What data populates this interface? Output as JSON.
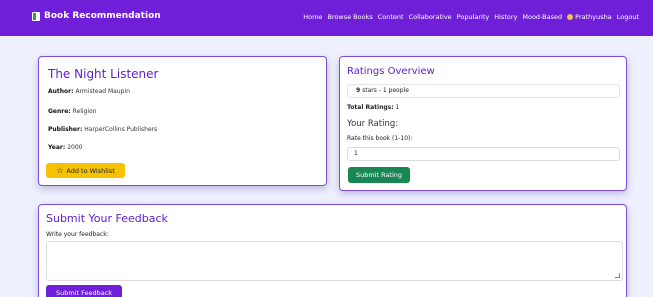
{
  "navbar": {
    "brand": "Book Recommendation",
    "links": [
      "Home",
      "Browse Books",
      "Content",
      "Collaborative",
      "Popularity",
      "History",
      "Mood-Based"
    ],
    "user": "Prathyusha",
    "logout": "Logout"
  },
  "book": {
    "title": "The Night Listener",
    "author_label": "Author:",
    "author": "Armistead Maupin",
    "genre_label": "Genre:",
    "genre": "Religion",
    "publisher_label": "Publisher:",
    "publisher": "HarperCollins Publishers",
    "year_label": "Year:",
    "year": "2000",
    "wishlist_button": "Add to Wishlist"
  },
  "ratings": {
    "title": "Ratings Overview",
    "row_stars": "9",
    "row_text": "stars - 1 people",
    "total_label": "Total Ratings:",
    "total_value": "1",
    "your_rating_heading": "Your Rating:",
    "rate_label": "Rate this book (1-10):",
    "rate_value": "1",
    "submit_button": "Submit Rating"
  },
  "feedback": {
    "title": "Submit Your Feedback",
    "label": "Write your feedback:",
    "value": "",
    "submit_button": "Submit Feedback"
  },
  "colors": {
    "accent": "#6f1fd8",
    "wishlist": "#f6c200",
    "submit_rating": "#198754"
  }
}
